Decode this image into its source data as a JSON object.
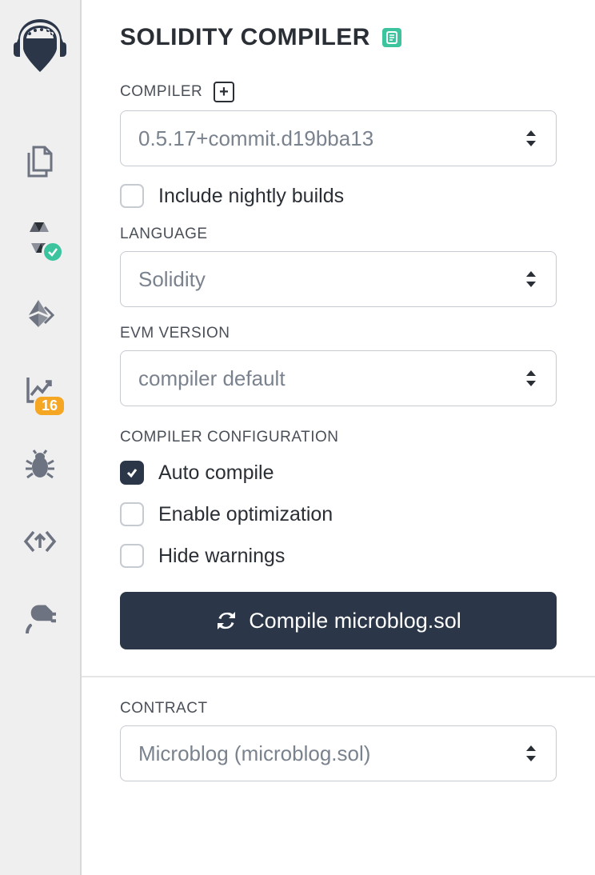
{
  "panel": {
    "title": "SOLIDITY COMPILER"
  },
  "sidebar": {
    "analysis_badge": "16"
  },
  "compiler": {
    "label": "COMPILER",
    "selected": "0.5.17+commit.d19bba13",
    "nightly_label": "Include nightly builds",
    "nightly_checked": false
  },
  "language": {
    "label": "LANGUAGE",
    "selected": "Solidity"
  },
  "evm": {
    "label": "EVM VERSION",
    "selected": "compiler default"
  },
  "config": {
    "label": "COMPILER CONFIGURATION",
    "auto_compile_label": "Auto compile",
    "auto_compile_checked": true,
    "optimize_label": "Enable optimization",
    "optimize_checked": false,
    "hide_warnings_label": "Hide warnings",
    "hide_warnings_checked": false
  },
  "compile_button": "Compile microblog.sol",
  "contract": {
    "label": "CONTRACT",
    "selected": "Microblog (microblog.sol)"
  }
}
